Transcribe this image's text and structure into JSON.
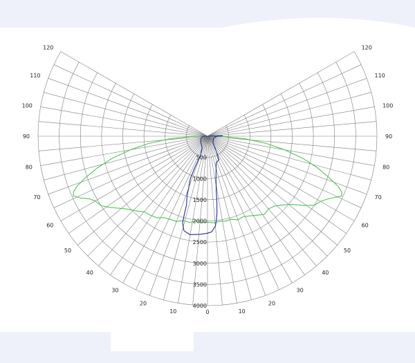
{
  "chart_data": {
    "type": "polar",
    "angle_ticks_left": [
      "120",
      "110",
      "100",
      "90",
      "80",
      "70",
      "60",
      "50",
      "40",
      "30",
      "20",
      "10"
    ],
    "angle_ticks_right": [
      "120",
      "110",
      "100",
      "90",
      "80",
      "70",
      "60",
      "50",
      "40",
      "30",
      "20",
      "10"
    ],
    "bottom_angle_label": "0",
    "radial_ticks": [
      "500",
      "1000",
      "1500",
      "2000",
      "2500",
      "3000",
      "3500",
      "4000"
    ],
    "radial_max": 4000,
    "angle_range_deg": [
      0,
      120
    ],
    "grid": true,
    "colors": {
      "green_series": "#4cc44c",
      "blue_series": "#1f2a9a",
      "grid": "#7a7a7a"
    },
    "series": [
      {
        "color_name": "green",
        "points": [
          {
            "angle": 90,
            "r": 0
          },
          {
            "angle": 89,
            "r": 380
          },
          {
            "angle": 86,
            "r": 900
          },
          {
            "angle": 83,
            "r": 1400
          },
          {
            "angle": 80,
            "r": 1850
          },
          {
            "angle": 77,
            "r": 2300
          },
          {
            "angle": 74,
            "r": 2700
          },
          {
            "angle": 71,
            "r": 3050
          },
          {
            "angle": 69,
            "r": 3300
          },
          {
            "angle": 67.5,
            "r": 3430
          },
          {
            "angle": 66,
            "r": 3470
          },
          {
            "angle": 64,
            "r": 3310
          },
          {
            "angle": 62,
            "r": 3180
          },
          {
            "angle": 60,
            "r": 3080
          },
          {
            "angle": 57,
            "r": 3000
          },
          {
            "angle": 54,
            "r": 2780
          },
          {
            "angle": 51,
            "r": 2560
          },
          {
            "angle": 48,
            "r": 2420
          },
          {
            "angle": 44,
            "r": 2290
          },
          {
            "angle": 40,
            "r": 2240
          },
          {
            "angle": 36,
            "r": 2280
          },
          {
            "angle": 32,
            "r": 2200
          },
          {
            "angle": 28,
            "r": 2130
          },
          {
            "angle": 24,
            "r": 2080
          },
          {
            "angle": 20,
            "r": 2100
          },
          {
            "angle": 16,
            "r": 2040
          },
          {
            "angle": 12,
            "r": 2050
          },
          {
            "angle": 8,
            "r": 2030
          },
          {
            "angle": 4,
            "r": 2050
          },
          {
            "angle": 0,
            "r": 2030
          },
          {
            "angle": -4,
            "r": 2050
          },
          {
            "angle": -8,
            "r": 2030
          },
          {
            "angle": -12,
            "r": 2080
          },
          {
            "angle": -16,
            "r": 2070
          },
          {
            "angle": -20,
            "r": 2140
          },
          {
            "angle": -24,
            "r": 2150
          },
          {
            "angle": -28,
            "r": 2180
          },
          {
            "angle": -32,
            "r": 2270
          },
          {
            "angle": -36,
            "r": 2300
          },
          {
            "angle": -40,
            "r": 2330
          },
          {
            "angle": -44,
            "r": 2450
          },
          {
            "angle": -48,
            "r": 2570
          },
          {
            "angle": -51,
            "r": 2700
          },
          {
            "angle": -54,
            "r": 2860
          },
          {
            "angle": -57,
            "r": 3000
          },
          {
            "angle": -60,
            "r": 3060
          },
          {
            "angle": -62,
            "r": 3150
          },
          {
            "angle": -64,
            "r": 3330
          },
          {
            "angle": -66,
            "r": 3470
          },
          {
            "angle": -67.5,
            "r": 3420
          },
          {
            "angle": -69,
            "r": 3300
          },
          {
            "angle": -71,
            "r": 3070
          },
          {
            "angle": -74,
            "r": 2700
          },
          {
            "angle": -77,
            "r": 2300
          },
          {
            "angle": -80,
            "r": 1850
          },
          {
            "angle": -83,
            "r": 1400
          },
          {
            "angle": -86,
            "r": 900
          },
          {
            "angle": -89,
            "r": 380
          },
          {
            "angle": -90,
            "r": 0
          }
        ]
      },
      {
        "color_name": "blue",
        "points": [
          {
            "angle": 0,
            "r": 0
          },
          {
            "angle": 92,
            "r": 350
          },
          {
            "angle": 90,
            "r": 220
          },
          {
            "angle": 70,
            "r": 150
          },
          {
            "angle": 40,
            "r": 200
          },
          {
            "angle": 30,
            "r": 420
          },
          {
            "angle": 26,
            "r": 620
          },
          {
            "angle": 18,
            "r": 660
          },
          {
            "angle": 14,
            "r": 840
          },
          {
            "angle": 11,
            "r": 1050
          },
          {
            "angle": 9,
            "r": 1330
          },
          {
            "angle": 8,
            "r": 1600
          },
          {
            "angle": 7,
            "r": 1830
          },
          {
            "angle": 6,
            "r": 2000
          },
          {
            "angle": 5,
            "r": 2130
          },
          {
            "angle": 2.5,
            "r": 2260
          },
          {
            "angle": 0,
            "r": 2290
          },
          {
            "angle": -4,
            "r": 2320
          },
          {
            "angle": -10,
            "r": 2360
          },
          {
            "angle": -14,
            "r": 2300
          },
          {
            "angle": -16,
            "r": 2130
          },
          {
            "angle": -16.5,
            "r": 1930
          },
          {
            "angle": -17,
            "r": 1700
          },
          {
            "angle": -19,
            "r": 1480
          },
          {
            "angle": -20,
            "r": 1300
          },
          {
            "angle": -22,
            "r": 1080
          },
          {
            "angle": -22,
            "r": 780
          },
          {
            "angle": -20,
            "r": 480
          },
          {
            "angle": -25,
            "r": 300
          },
          {
            "angle": -45,
            "r": 220
          },
          {
            "angle": -70,
            "r": 170
          },
          {
            "angle": -90,
            "r": 100
          },
          {
            "angle": 0,
            "r": 0
          }
        ]
      }
    ]
  }
}
